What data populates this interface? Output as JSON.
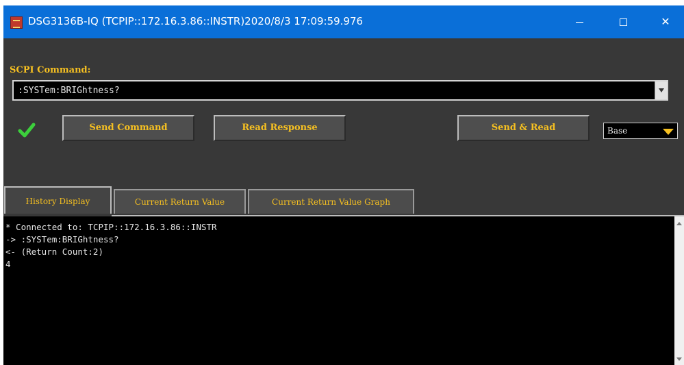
{
  "window": {
    "title": "DSG3136B-IQ (TCPIP::172.16.3.86::INSTR)2020/8/3 17:09:59.976",
    "controls": [
      "minimize-icon",
      "maximize-icon",
      "close-icon"
    ],
    "close_glyph": "✕"
  },
  "scpi": {
    "label": "SCPI Command:",
    "value": ":SYSTem:BRIGhtness?"
  },
  "status_icon": "check-icon",
  "buttons": {
    "send": "Send Command",
    "read": "Read Response",
    "send_read": "Send & Read"
  },
  "base_select": {
    "value": "Base"
  },
  "tabs": [
    {
      "label": "History Display",
      "active": true
    },
    {
      "label": "Current Return Value",
      "active": false
    },
    {
      "label": "Current Return Value Graph",
      "active": false
    }
  ],
  "history": [
    "* Connected to: TCPIP::172.16.3.86::INSTR",
    "-> :SYSTem:BRIGhtness?",
    "<- (Return Count:2)",
    "4"
  ],
  "colors": {
    "titlebar": "#0a6fd8",
    "panel": "#383838",
    "accent_text": "#f6c021",
    "history_bg": "#000000"
  }
}
